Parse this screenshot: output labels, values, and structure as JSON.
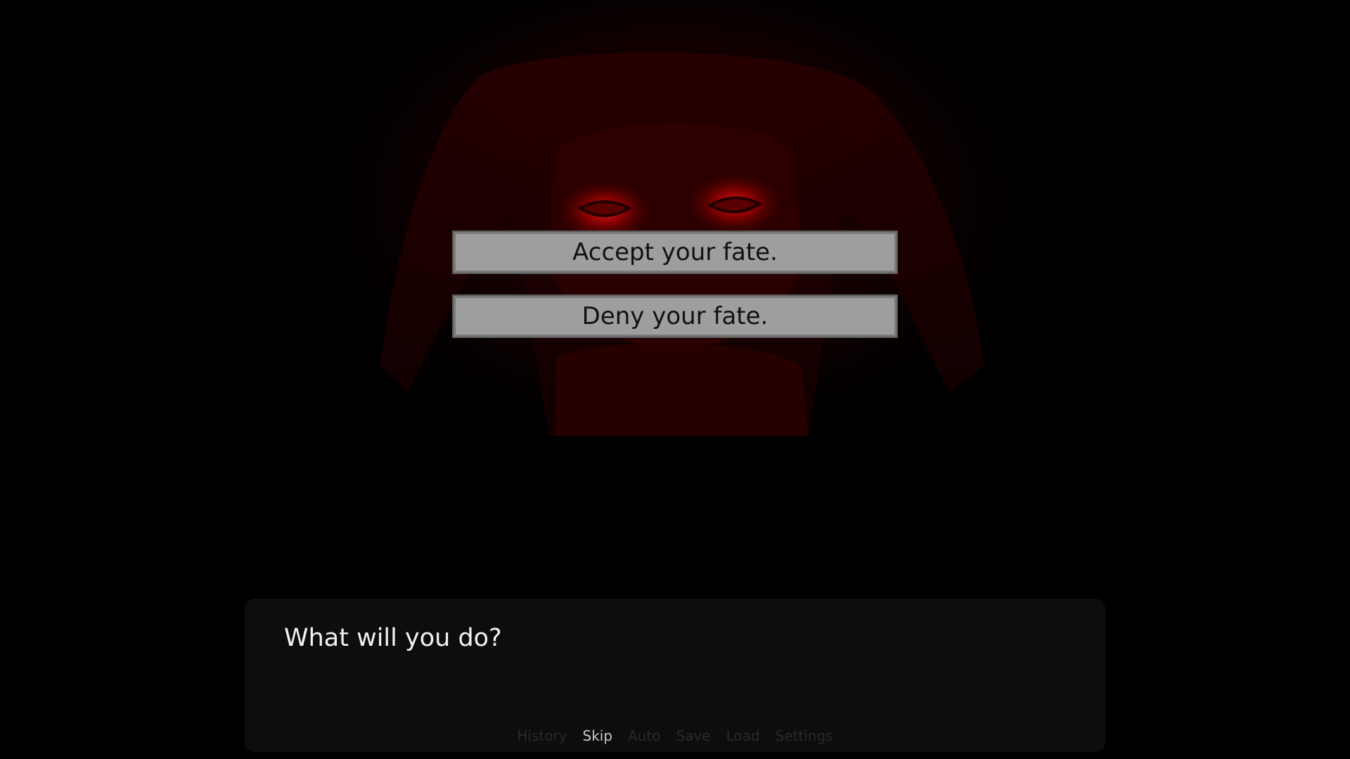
{
  "choices": [
    {
      "label": "Accept your fate."
    },
    {
      "label": "Deny your fate."
    }
  ],
  "dialogue": {
    "text": "What will you do?"
  },
  "quick_menu": {
    "items": [
      {
        "label": "History",
        "highlighted": false
      },
      {
        "label": "Skip",
        "highlighted": true
      },
      {
        "label": "Auto",
        "highlighted": false
      },
      {
        "label": "Save",
        "highlighted": false
      },
      {
        "label": "Load",
        "highlighted": false
      },
      {
        "label": "Settings",
        "highlighted": false
      }
    ]
  },
  "colors": {
    "background": "#000000",
    "character_glow": "#5a0000",
    "eye_glow": "#ff1a1a",
    "choice_fill": "#9e9e9e",
    "textbox": "#0e0e0e"
  }
}
